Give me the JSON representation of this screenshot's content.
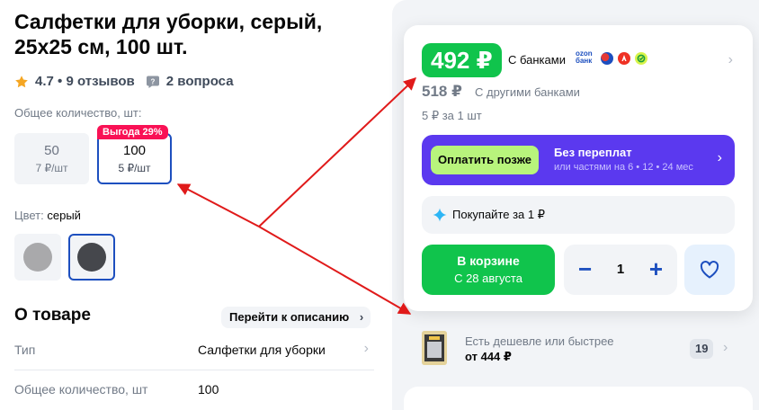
{
  "product": {
    "title": "Салфетки для уборки, серый, 25x25 см, 100 шт.",
    "rating": "4.7",
    "reviews": "9 отзывов",
    "questions": "2 вопроса"
  },
  "quantity": {
    "label": "Общее количество, шт:",
    "options": [
      {
        "count": "50",
        "unit_price": "7 ₽/шт"
      },
      {
        "count": "100",
        "unit_price": "5 ₽/шт",
        "badge": "Выгода 29%"
      }
    ],
    "selected_index": 1
  },
  "color": {
    "label": "Цвет:",
    "value": "серый",
    "swatches": [
      "#a9a9ab",
      "#45474c"
    ],
    "selected_index": 1
  },
  "about": {
    "title": "О товаре",
    "link": "Перейти к описанию",
    "specs": [
      {
        "key": "Тип",
        "value": "Салфетки для уборки"
      },
      {
        "key": "Общее количество, шт",
        "value": "100"
      }
    ]
  },
  "buy_box": {
    "price": "492 ₽",
    "price_note": "С банками",
    "bank_logo_text": [
      "ozon",
      "банк"
    ],
    "old_price": "518 ₽",
    "old_price_note": "С другими банками",
    "per_unit": "5 ₽ за 1 шт",
    "bnpl": {
      "button": "Оплатить позже",
      "title": "Без переплат",
      "subtitle": "или частями на 6 • 12 • 24 мес"
    },
    "promo": "Покупайте за 1 ₽",
    "cart": {
      "label": "В корзине",
      "delivery": "С 28 августа"
    },
    "stepper": {
      "minus": "−",
      "value": "1",
      "plus": "+"
    }
  },
  "cheaper": {
    "title": "Есть дешевле или быстрее",
    "price": "от 444 ₽",
    "count": "19"
  },
  "colors": {
    "accent": "#1d4fbf",
    "green": "#10c44c",
    "purple": "#5b39ef",
    "sale": "#f91155",
    "arrow": "#e01a1a"
  }
}
